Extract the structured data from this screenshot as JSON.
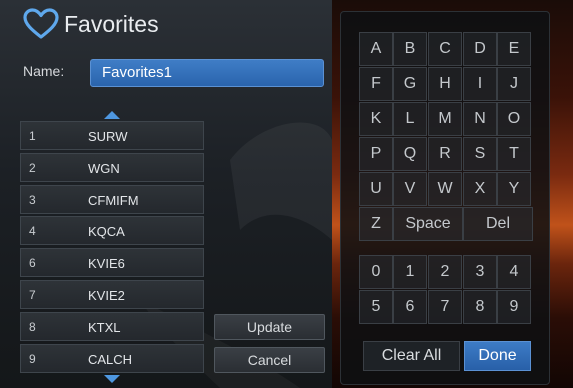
{
  "header": {
    "title": "Favorites",
    "icon": "heart-outline-icon"
  },
  "name": {
    "label": "Name:",
    "value": "Favorites1"
  },
  "channels": [
    {
      "number": "1",
      "name": "SURW"
    },
    {
      "number": "2",
      "name": "WGN"
    },
    {
      "number": "3",
      "name": "CFMIFM"
    },
    {
      "number": "4",
      "name": "KQCA"
    },
    {
      "number": "6",
      "name": "KVIE6"
    },
    {
      "number": "7",
      "name": "KVIE2"
    },
    {
      "number": "8",
      "name": "KTXL"
    },
    {
      "number": "9",
      "name": "CALCH"
    }
  ],
  "buttons": {
    "update": "Update",
    "cancel": "Cancel",
    "clear_all": "Clear All",
    "done": "Done"
  },
  "keyboard": {
    "letter_rows": [
      [
        "A",
        "B",
        "C",
        "D",
        "E"
      ],
      [
        "F",
        "G",
        "H",
        "I",
        "J"
      ],
      [
        "K",
        "L",
        "M",
        "N",
        "O"
      ],
      [
        "P",
        "Q",
        "R",
        "S",
        "T"
      ],
      [
        "U",
        "V",
        "W",
        "X",
        "Y"
      ]
    ],
    "last_row": {
      "letter": "Z",
      "space": "Space",
      "del": "Del"
    },
    "digit_rows": [
      [
        "0",
        "1",
        "2",
        "3",
        "4"
      ],
      [
        "5",
        "6",
        "7",
        "8",
        "9"
      ]
    ]
  },
  "colors": {
    "accent": "#3574c0",
    "panel": "#1c2025",
    "key_text": "#c4c8cc"
  }
}
